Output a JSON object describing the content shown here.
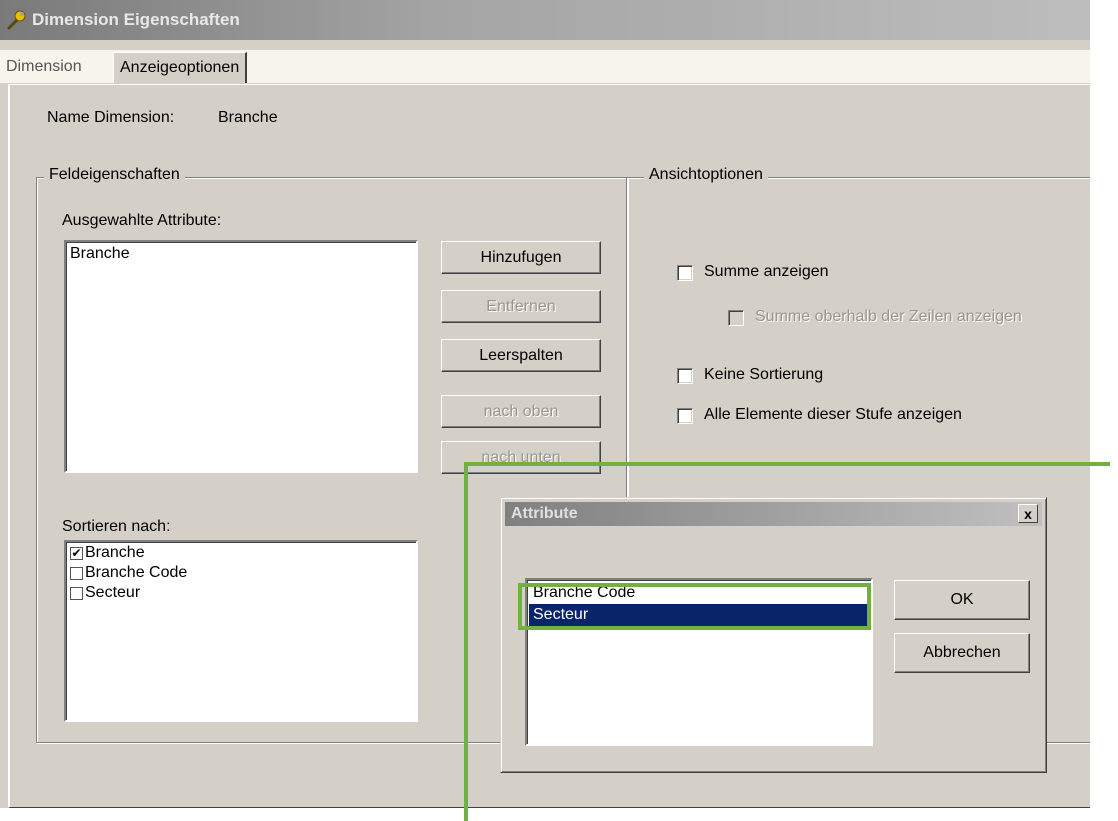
{
  "window": {
    "title": "Dimension Eigenschaften"
  },
  "tabs": [
    {
      "label": "Dimension"
    },
    {
      "label": "Anzeigeoptionen"
    }
  ],
  "name_dimension": {
    "label": "Name Dimension:",
    "value": "Branche"
  },
  "feldeigenschaften": {
    "legend": "Feldeigenschaften",
    "selected_label": "Ausgewahlte Attribute:",
    "selected_items": [
      "Branche"
    ],
    "buttons": {
      "add": "Hinzufugen",
      "remove": "Entfernen",
      "empty_columns": "Leerspalten",
      "up": "nach oben",
      "down": "nach unten"
    },
    "sort_label": "Sortieren nach:",
    "sort_items": [
      {
        "label": "Branche",
        "checked": true
      },
      {
        "label": "Branche Code",
        "checked": false
      },
      {
        "label": "Secteur",
        "checked": false
      }
    ]
  },
  "ansichtoptionen": {
    "legend": "Ansichtoptionen",
    "show_sum": "Summe anzeigen",
    "sum_above": "Summe oberhalb der Zeilen anzeigen",
    "no_sort": "Keine Sortierung",
    "show_all": "Alle Elemente dieser Stufe anzeigen"
  },
  "dialog": {
    "title": "Attribute",
    "close_glyph": "x",
    "items": [
      {
        "label": "Branche Code",
        "selected": false
      },
      {
        "label": "Secteur",
        "selected": true
      }
    ],
    "ok": "OK",
    "cancel": "Abbrechen"
  },
  "colors": {
    "window_bg": "#d4d0c8",
    "selection": "#0a246a",
    "annotation_green": "#72b043"
  },
  "icons": {
    "title_icon": "wrench-icon",
    "close_icon": "close-icon",
    "check_icon": "checkmark-icon"
  }
}
